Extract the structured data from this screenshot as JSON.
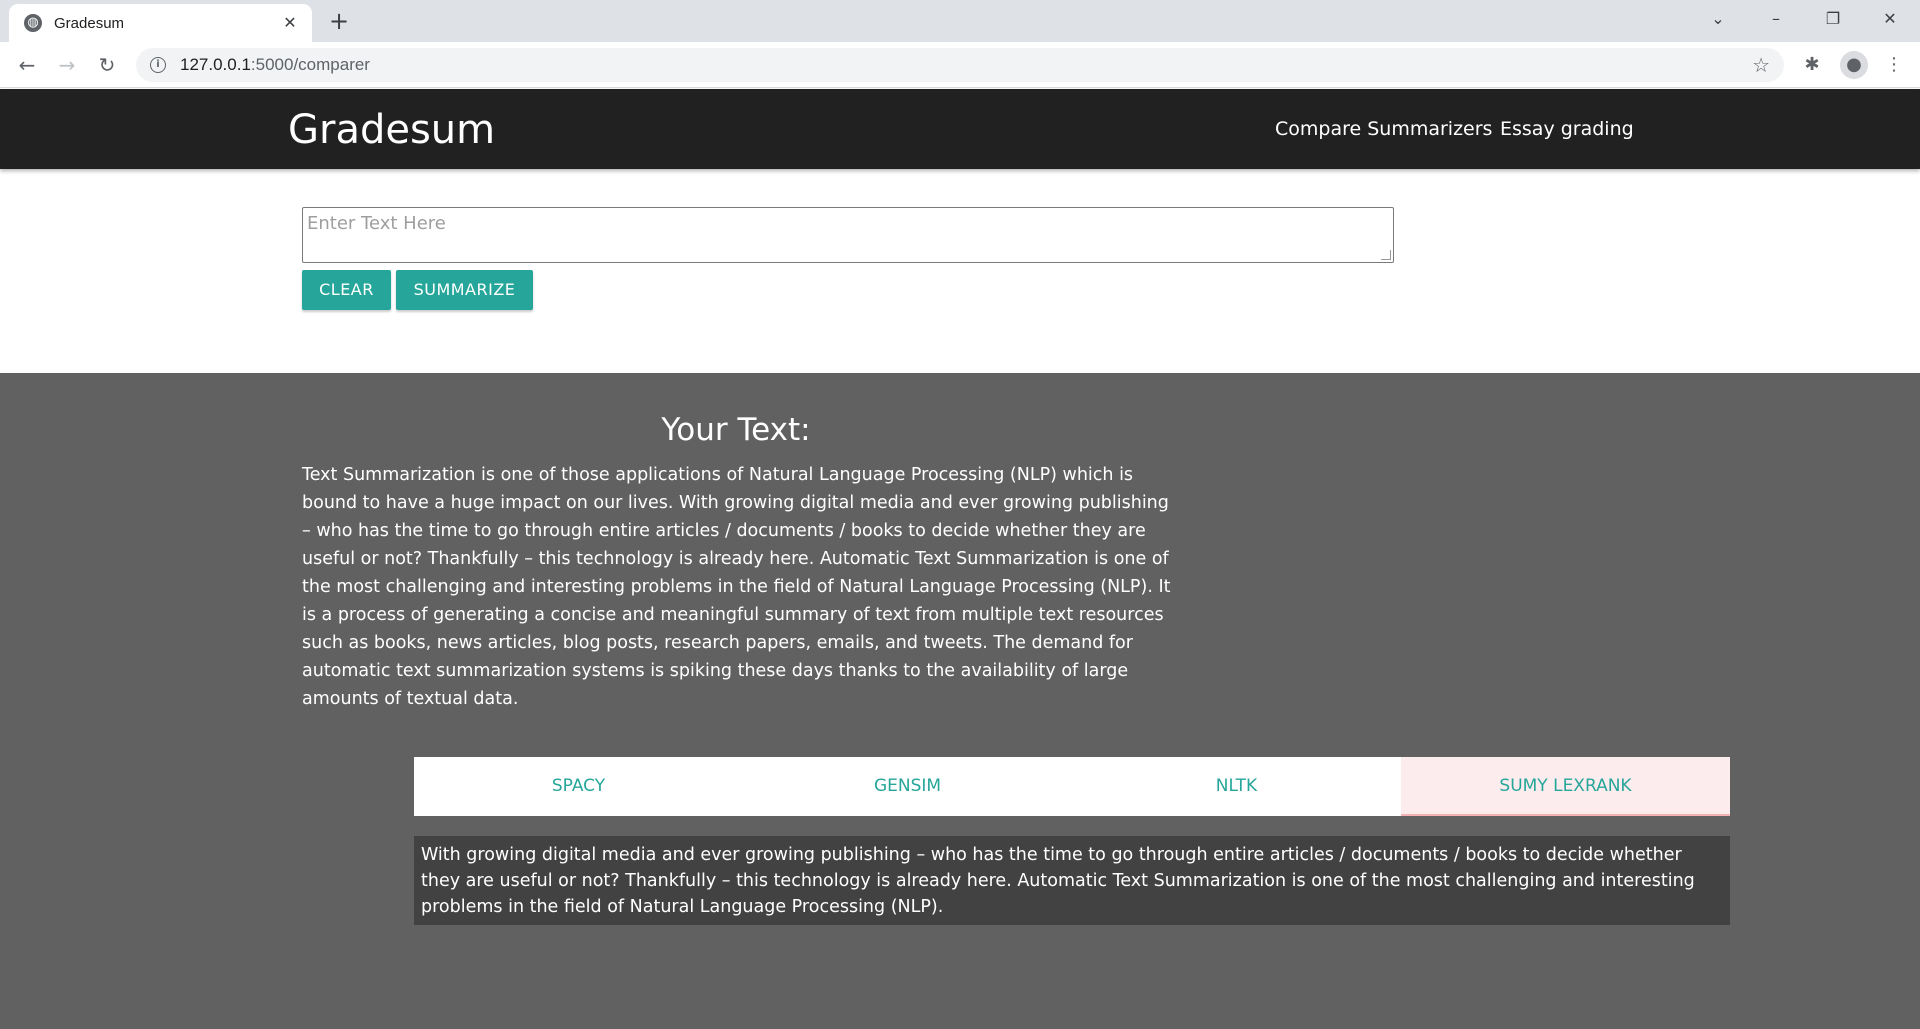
{
  "browser": {
    "tab_title": "Gradesum",
    "url_host": "127.0.0.1",
    "url_path": ":5000/comparer",
    "icons": {
      "favicon": "globe-icon",
      "close": "close-icon",
      "new_tab": "plus-icon",
      "back": "back-arrow-icon",
      "forward": "forward-arrow-icon",
      "reload": "reload-icon",
      "info": "info-icon",
      "bookmark": "star-icon",
      "extensions": "puzzle-icon",
      "profile": "profile-icon",
      "menu": "kebab-menu-icon"
    }
  },
  "navbar": {
    "brand": "Gradesum",
    "links": [
      "Compare Summarizers",
      "Essay grading"
    ]
  },
  "input": {
    "placeholder": "Enter Text Here",
    "clear_label": "CLEAR",
    "summarize_label": "SUMMARIZE"
  },
  "your_text": {
    "title": "Your Text:",
    "body": "Text Summarization is one of those applications of Natural Language Processing (NLP) which is bound to have a huge impact on our lives. With growing digital media and ever growing publishing – who has the time to go through entire articles / documents / books to decide whether they are useful or not? Thankfully – this technology is already here. Automatic Text Summarization is one of the most challenging and interesting problems in the field of Natural Language Processing (NLP). It is a process of generating a concise and meaningful summary of text from multiple text resources such as books, news articles, blog posts, research papers, emails, and tweets. The demand for automatic text summarization systems is spiking these days thanks to the availability of large amounts of textual data."
  },
  "summarizer_tabs": {
    "items": [
      "SPACY",
      "GENSIM",
      "NLTK",
      "SUMY LEXRANK"
    ],
    "active": "SUMY LEXRANK"
  },
  "summary": {
    "text": "With growing digital media and ever growing publishing – who has the time to go through entire articles / documents / books to decide whether they are useful or not? Thankfully – this technology is already here. Automatic Text Summarization is one of the most challenging and interesting problems in the field of Natural Language Processing (NLP)."
  },
  "colors": {
    "navbar_bg": "#212121",
    "accent": "#26a69a",
    "section_bg": "#616161",
    "summary_bg": "#424242",
    "active_tab_bg": "#fdecee"
  }
}
